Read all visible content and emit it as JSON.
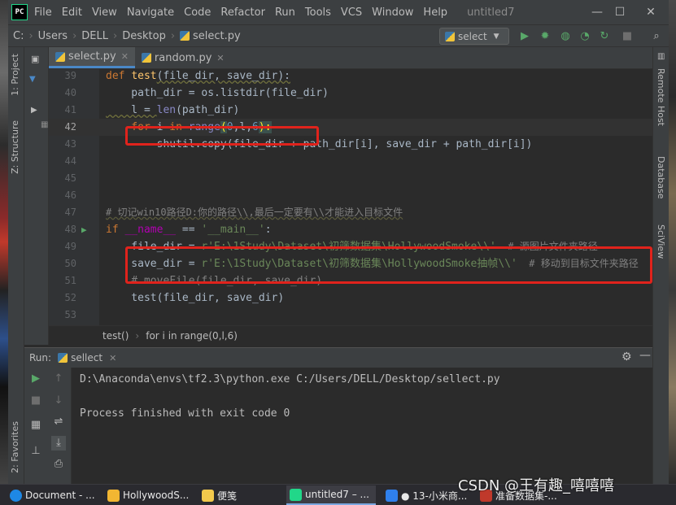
{
  "title_bar": {
    "menu": [
      "File",
      "Edit",
      "View",
      "Navigate",
      "Code",
      "Refactor",
      "Run",
      "Tools",
      "VCS",
      "Window",
      "Help"
    ],
    "project_name": "untitled7",
    "minimize": "—",
    "maximize": "☐",
    "close": "✕"
  },
  "nav_bar": {
    "breadcrumbs": [
      "C:",
      "Users",
      "DELL",
      "Desktop",
      "select.py"
    ],
    "run_config": "select"
  },
  "left_strip": {
    "project_tab": "1: Project",
    "structure_tab": "Z: Structure",
    "favorites_tab": "2: Favorites"
  },
  "right_strip": {
    "tabs": [
      "Remote Host",
      "Database",
      "SciView"
    ]
  },
  "editor_tabs": [
    {
      "label": "select.py",
      "active": true
    },
    {
      "label": "random.py",
      "active": false
    }
  ],
  "code_lines": [
    {
      "num": "39"
    },
    {
      "num": "40"
    },
    {
      "num": "41"
    },
    {
      "num": "42"
    },
    {
      "num": "43"
    },
    {
      "num": "44"
    },
    {
      "num": "45"
    },
    {
      "num": "46"
    },
    {
      "num": "47"
    },
    {
      "num": "48"
    },
    {
      "num": "49"
    },
    {
      "num": "50"
    },
    {
      "num": "51"
    },
    {
      "num": "52"
    },
    {
      "num": "53"
    }
  ],
  "code": {
    "l39_def": "def ",
    "l39_name": "test",
    "l39_rest": "(file_dir, save_dir):",
    "l40": "    path_dir = os.listdir(file_dir)",
    "l41_a": "    l = ",
    "l41_b": "len",
    "l41_c": "(path_dir)",
    "l42_for": "    for ",
    "l42_i": "i ",
    "l42_in": "in ",
    "l42_range": "range",
    "l42_open": "(",
    "l42_zero": "0",
    "l42_mid": ",l,",
    "l42_six": "6",
    "l42_close": "):",
    "l43": "        shutil.copy(file_dir + path_dir[i], save_dir + path_dir[i])",
    "l47": "# 切记win10路径D:你的路径\\\\,最后一定要有\\\\才能进入目标文件",
    "l48_if": "if ",
    "l48_name": "__name__",
    "l48_eq": " == ",
    "l48_str": "'__main__'",
    "l48_colon": ":",
    "l49_var": "    file_dir = ",
    "l49_str": "r'E:\\1Study\\Dataset\\初筛数据集\\HollywoodSmoke\\\\'",
    "l49_cmt": "  # 源图片文件夹路径",
    "l50_var": "    save_dir = ",
    "l50_str": "r'E:\\1Study\\Dataset\\初筛数据集\\HollywoodSmoke抽帧\\\\'",
    "l50_cmt": "  # 移动到目标文件夹路径",
    "l51": "    # moveFile(file_dir, save_dir)",
    "l52": "    test(file_dir, save_dir)"
  },
  "code_breadcrumbs": [
    "test()",
    "for i in range(0,l,6)"
  ],
  "run_panel": {
    "label": "Run:",
    "tab": "sellect",
    "console": [
      "D:\\Anaconda\\envs\\tf2.3\\python.exe C:/Users/DELL/Desktop/sellect.py",
      "",
      "Process finished with exit code 0"
    ]
  },
  "taskbar": [
    {
      "label": "Document - ...",
      "color": "#1e88e5"
    },
    {
      "label": "HollywoodS...",
      "color": "#f2b632"
    },
    {
      "label": "便笺",
      "color": "#f2c94c"
    },
    {
      "label": "untitled7 – ...",
      "color": "#21d789"
    },
    {
      "label": "● 13-小米商...",
      "color": "#2f80ed"
    },
    {
      "label": "准备数据集-...",
      "color": "#c0392b"
    }
  ],
  "watermark": "CSDN @王有趣_嘻嘻嘻",
  "colors": {
    "annotation": "#e0231c",
    "keyword": "#cc7832",
    "string": "#6a8759",
    "comment": "#808080",
    "number": "#6897bb"
  }
}
